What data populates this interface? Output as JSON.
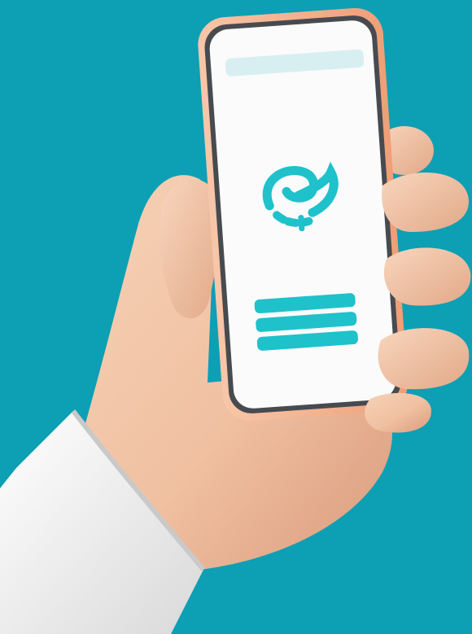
{
  "scene": {
    "background_color": "#0d9fb4",
    "skin_color": "#f3c7a7",
    "skin_shadow_color": "#d89c7d",
    "case_color": "#f4ae88",
    "bezel_color": "#474b50",
    "screen_color": "#fbfbfb",
    "sleeve_color": "#f2f2f2",
    "accent_color": "#1fc1cb"
  },
  "phone_screen": {
    "top_bar": {
      "color": "#d8eff1"
    },
    "logo": {
      "icon": "leaf-swirl-logo-icon",
      "color": "#1fc1cb"
    },
    "text_lines": [
      {
        "color": "#1fc1cb"
      },
      {
        "color": "#1fc1cb"
      },
      {
        "color": "#1fc1cb"
      }
    ]
  }
}
